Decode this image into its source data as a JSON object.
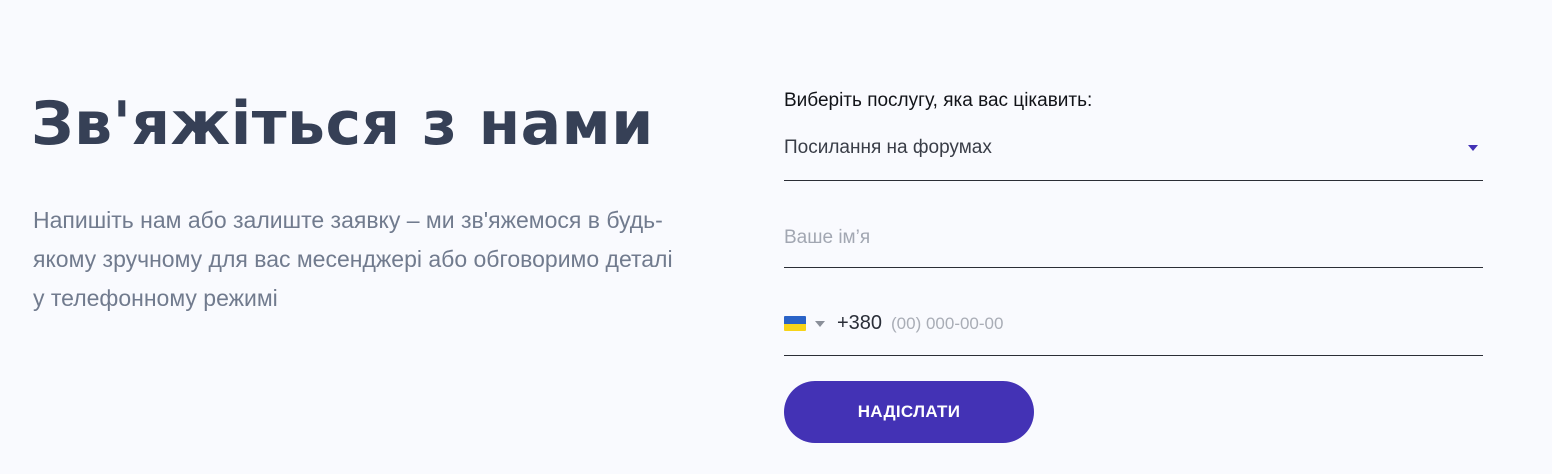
{
  "contact": {
    "title": "Зв'яжіться з нами",
    "subtitle": "Напишіть нам або залиште заявку – ми зв'яжемося в будь-якому зручному для вас месенджері або обговоримо деталі у телефонному режимі"
  },
  "form": {
    "service_label": "Виберіть послугу, яка вас цікавить:",
    "service_selected": "Посилання на форумах",
    "name_placeholder": "Ваше ім’я",
    "phone": {
      "country_flag": "ukraine-flag-icon",
      "dial_code": "+380",
      "placeholder": "(00) 000-00-00"
    },
    "submit_label": "НАДІСЛАТИ"
  },
  "colors": {
    "background": "#f9fafe",
    "accent": "#4332b5",
    "title": "#364056",
    "subtitle": "#717b8e"
  }
}
